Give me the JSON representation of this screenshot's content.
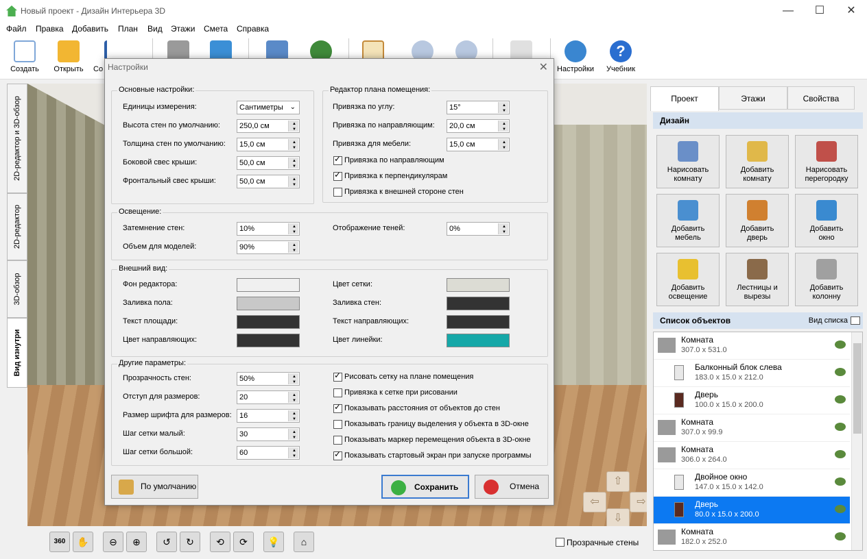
{
  "app": {
    "title": "Новый проект - Дизайн Интерьера 3D"
  },
  "menu": [
    "Файл",
    "Правка",
    "Добавить",
    "План",
    "Вид",
    "Этажи",
    "Смета",
    "Справка"
  ],
  "toolbar": {
    "create": "Создать",
    "open": "Открыть",
    "save": "Со",
    "settings": "Настройки",
    "tutorial": "Учебник"
  },
  "left_tabs": [
    "2D-редактор и 3D-обзор",
    "2D-редактор",
    "3D-обзор",
    "Вид изнутри"
  ],
  "right_panel": {
    "tabs": [
      "Проект",
      "Этажи",
      "Свойства"
    ],
    "design_header": "Дизайн",
    "tiles": [
      {
        "l1": "Нарисовать",
        "l2": "комнату",
        "color": "#6a8fc8"
      },
      {
        "l1": "Добавить",
        "l2": "комнату",
        "color": "#e0b84a"
      },
      {
        "l1": "Нарисовать",
        "l2": "перегородку",
        "color": "#c0504a"
      },
      {
        "l1": "Добавить",
        "l2": "мебель",
        "color": "#4a8fd0"
      },
      {
        "l1": "Добавить",
        "l2": "дверь",
        "color": "#d08030"
      },
      {
        "l1": "Добавить",
        "l2": "окно",
        "color": "#3a8ad0"
      },
      {
        "l1": "Добавить",
        "l2": "освещение",
        "color": "#e8c030"
      },
      {
        "l1": "Лестницы и",
        "l2": "вырезы",
        "color": "#8a6a4a"
      },
      {
        "l1": "Добавить",
        "l2": "колонну",
        "color": "#a0a0a0"
      }
    ],
    "objects_header": "Список объектов",
    "view_list": "Вид списка",
    "objects": [
      {
        "name": "Комната",
        "dims": "307.0 x 531.0",
        "indent": false,
        "sel": false
      },
      {
        "name": "Балконный блок слева",
        "dims": "183.0 x 15.0 x 212.0",
        "indent": true,
        "sel": false
      },
      {
        "name": "Дверь",
        "dims": "100.0 x 15.0 x 200.0",
        "indent": true,
        "sel": false
      },
      {
        "name": "Комната",
        "dims": "307.0 x 99.9",
        "indent": false,
        "sel": false
      },
      {
        "name": "Комната",
        "dims": "306.0 x 264.0",
        "indent": false,
        "sel": false
      },
      {
        "name": "Двойное окно",
        "dims": "147.0 x 15.0 x 142.0",
        "indent": true,
        "sel": false
      },
      {
        "name": "Дверь",
        "dims": "80.0 x 15.0 x 200.0",
        "indent": true,
        "sel": true
      },
      {
        "name": "Комната",
        "dims": "182.0 x 252.0",
        "indent": false,
        "sel": false
      }
    ]
  },
  "bottom": {
    "transparent_walls": "Прозрачные стены",
    "btn_360": "360"
  },
  "dialog": {
    "title": "Настройки",
    "basic": {
      "title": "Основные настройки:",
      "rows": [
        {
          "label": "Единицы измерения:",
          "value": "Сантиметры"
        },
        {
          "label": "Высота стен по умолчанию:",
          "value": "250,0 см"
        },
        {
          "label": "Толщина стен по умолчанию:",
          "value": "15,0 см"
        },
        {
          "label": "Боковой свес крыши:",
          "value": "50,0 см"
        },
        {
          "label": "Фронтальный свес крыши:",
          "value": "50,0 см"
        }
      ]
    },
    "planner": {
      "title": "Редактор плана помещения:",
      "rows": [
        {
          "label": "Привязка по углу:",
          "value": "15°"
        },
        {
          "label": "Привязка по направляющим:",
          "value": "20,0 см"
        },
        {
          "label": "Привязка для мебели:",
          "value": "15,0 см"
        }
      ],
      "checks": [
        {
          "label": "Привязка по направляющим",
          "on": true
        },
        {
          "label": "Привязка к перпендикулярам",
          "on": true
        },
        {
          "label": "Привязка к внешней стороне стен",
          "on": false
        }
      ]
    },
    "lighting": {
      "title": "Освещение:",
      "rows": [
        {
          "label": "Затемнение стен:",
          "value": "10%"
        },
        {
          "label": "Объем для моделей:",
          "value": "90%"
        },
        {
          "label": "Отображение теней:",
          "value": "0%"
        }
      ]
    },
    "appearance": {
      "title": "Внешний вид:",
      "rows": [
        {
          "label": "Фон редактора:",
          "color": "#f0f0f0"
        },
        {
          "label": "Заливка пола:",
          "color": "#c8c8c8"
        },
        {
          "label": "Текст площади:",
          "color": "#333333"
        },
        {
          "label": "Цвет направляющих:",
          "color": "#333333"
        },
        {
          "label": "Цвет сетки:",
          "color": "#dcdcd4"
        },
        {
          "label": "Заливка стен:",
          "color": "#333333"
        },
        {
          "label": "Текст направляющих:",
          "color": "#333333"
        },
        {
          "label": "Цвет линейки:",
          "color": "#16a8a8"
        }
      ]
    },
    "other": {
      "title": "Другие параметры:",
      "rows": [
        {
          "label": "Прозрачность стен:",
          "value": "50%"
        },
        {
          "label": "Отступ для размеров:",
          "value": "20"
        },
        {
          "label": "Размер шрифта для размеров:",
          "value": "16"
        },
        {
          "label": "Шаг сетки малый:",
          "value": "30"
        },
        {
          "label": "Шаг сетки большой:",
          "value": "60"
        }
      ],
      "checks": [
        {
          "label": "Рисовать сетку на плане помещения",
          "on": true
        },
        {
          "label": "Привязка к сетке при рисовании",
          "on": false
        },
        {
          "label": "Показывать расстояния от объектов до стен",
          "on": true
        },
        {
          "label": "Показывать границу выделения у объекта в 3D-окне",
          "on": false
        },
        {
          "label": "Показывать маркер перемещения объекта в 3D-окне",
          "on": false
        },
        {
          "label": "Показывать стартовый экран при запуске программы",
          "on": true
        }
      ]
    },
    "buttons": {
      "default": "По умолчанию",
      "save": "Сохранить",
      "cancel": "Отмена"
    }
  }
}
